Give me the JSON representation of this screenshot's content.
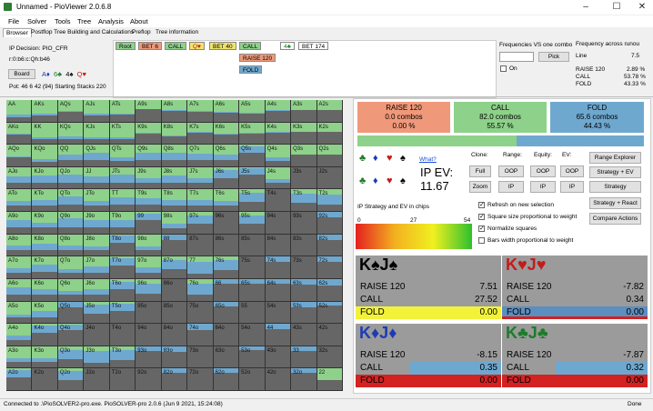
{
  "window": {
    "title": "Unnamed - PioViewer 2.0.6.8"
  },
  "menu": [
    "File",
    "Solver",
    "Tools",
    "Tree",
    "Analysis",
    "About"
  ],
  "tabs": [
    "Browser",
    "Postflop Tree Building and Calculations",
    "Preflop",
    "Tree information"
  ],
  "info": {
    "decision": "IP Decision:  PIO_CFR",
    "board_code": "r:0:b6:c:Qh:b46",
    "board_button": "Board",
    "board_cards": [
      "A♦",
      "6♣",
      "4♠",
      "Q♥"
    ],
    "pot_line": "Pot: 46 6 42 (94) Starting Stacks 220"
  },
  "tree_nodes": {
    "row1": [
      "Root",
      "BET 6",
      "CALL",
      "Q♥",
      "BET 40",
      "CALL",
      "4♣",
      "BET 174"
    ],
    "row2": "RAISE 120",
    "row3": "FOLD"
  },
  "freq_panel": {
    "title": "Frequencies VS one combo",
    "pick": "Pick",
    "on_label": "On"
  },
  "freq_across": {
    "title": "Frequency across runou",
    "line_label": "Line",
    "line_value": "7.5",
    "rows": [
      {
        "label": "RAISE 120",
        "value": "2.89 %"
      },
      {
        "label": "CALL",
        "value": "53.78 %"
      },
      {
        "label": "FOLD",
        "value": "43.33 %"
      }
    ]
  },
  "summary": [
    {
      "action": "RAISE 120",
      "combos": "0.0 combos",
      "pct": "0.00 %",
      "color": "#f0997a"
    },
    {
      "action": "CALL",
      "combos": "82.0 combos",
      "pct": "55.57 %",
      "color": "#8ed18a"
    },
    {
      "action": "FOLD",
      "combos": "65.6 combos",
      "pct": "44.43 %",
      "color": "#6fa8cf"
    }
  ],
  "ev": {
    "what_link": "What?",
    "label": "IP EV:",
    "value": "11.67",
    "strategy_label": "IP Strategy and EV in chips",
    "scale": [
      "0",
      "27",
      "54"
    ]
  },
  "controls": {
    "clone": "Clone:",
    "range": "Range:",
    "equity": "Equity:",
    "ev": "EV:",
    "full": "Full",
    "oop1": "OOP",
    "oop2": "OOP",
    "oop3": "OOP",
    "zoom": "Zoom",
    "ip1": "IP",
    "ip2": "IP",
    "ip3": "IP",
    "range_explorer": "Range Explorer",
    "strategy_ev": "Strategy + EV",
    "strategy": "Strategy",
    "strategy_react": "Strategy + React",
    "compare_actions": "Compare Actions"
  },
  "checkboxes": [
    {
      "label": "Refresh on new selection",
      "checked": true
    },
    {
      "label": "Square size proportional to weight",
      "checked": true
    },
    {
      "label": "Normalize squares",
      "checked": true
    },
    {
      "label": "Bars width proportional to weight",
      "checked": false
    }
  ],
  "hands": [
    {
      "name": "K♠J♠",
      "suitColor": "#000",
      "rows": [
        {
          "k": "RAISE 120",
          "v": "7.51"
        },
        {
          "k": "CALL",
          "v": "27.52"
        },
        {
          "k": "FOLD",
          "v": "0.00"
        }
      ],
      "fold_bg": "#f2f23a"
    },
    {
      "name": "K♥J♥",
      "suitColor": "#c41b1b",
      "rows": [
        {
          "k": "RAISE 120",
          "v": "-7.82"
        },
        {
          "k": "CALL",
          "v": "0.34"
        },
        {
          "k": "FOLD",
          "v": "0.00"
        }
      ],
      "fold_bg": "#5b8fc0"
    },
    {
      "name": "K♦J♦",
      "suitColor": "#1d3bb3",
      "rows": [
        {
          "k": "RAISE 120",
          "v": "-8.15"
        },
        {
          "k": "CALL",
          "v": "0.35"
        },
        {
          "k": "FOLD",
          "v": "0.00"
        }
      ],
      "fold_bg": "#d22222"
    },
    {
      "name": "K♣J♣",
      "suitColor": "#1e7b2a",
      "rows": [
        {
          "k": "RAISE 120",
          "v": "-7.87"
        },
        {
          "k": "CALL",
          "v": "0.32"
        },
        {
          "k": "FOLD",
          "v": "0.00"
        }
      ],
      "fold_bg": "#d22222"
    }
  ],
  "status": {
    "left": "Connected to .\\PioSOLVER2-pro.exe. PioSOLVER-pro 2.0.6 (Jun  9 2021, 15:24:08)",
    "right": "Done"
  },
  "ranks": [
    "A",
    "K",
    "Q",
    "J",
    "T",
    "9",
    "8",
    "7",
    "6",
    "5",
    "4",
    "3",
    "2"
  ],
  "colors": {
    "call": "#8ed18a",
    "fold": "#6fa8cf",
    "raise": "#f0997a",
    "empty": "#666666"
  }
}
